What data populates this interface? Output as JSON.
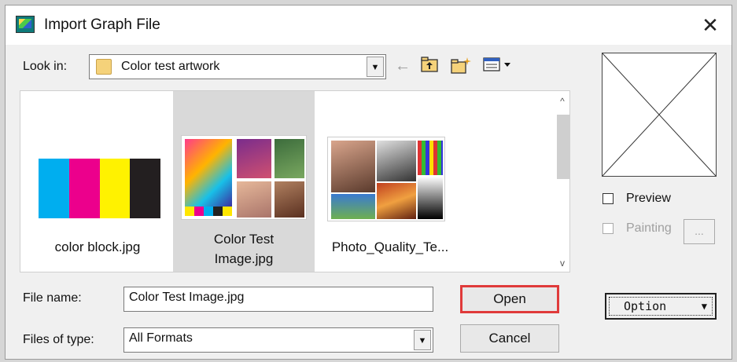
{
  "window": {
    "title": "Import Graph File",
    "close_glyph": "✕"
  },
  "lookin": {
    "label": "Look in:",
    "value": "Color test artwork",
    "icon": "folder-icon"
  },
  "toolbar": {
    "back_glyph": "←",
    "up_glyph": "⇧",
    "newfolder_glyph": "✳",
    "view_glyph": "▦▾"
  },
  "files": [
    {
      "name": "color block.jpg",
      "selected": false
    },
    {
      "name_line1": "Color Test",
      "name_line2": "Image.jpg",
      "selected": true
    },
    {
      "name": "Photo_Quality_Te...",
      "selected": false
    }
  ],
  "scroll": {
    "up_glyph": "^",
    "down_glyph": "v"
  },
  "preview": {
    "preview_label": "Preview",
    "painting_label": "Painting",
    "dots_label": "..."
  },
  "filename": {
    "label": "File name:",
    "value": "Color Test Image.jpg"
  },
  "filetype": {
    "label": "Files of type:",
    "value": "All Formats"
  },
  "buttons": {
    "open": "Open",
    "cancel": "Cancel",
    "option": "Option",
    "option_arrow": "▼"
  },
  "colors": {
    "highlight_red": "#e03a3a",
    "selection_gray": "#d9d9d9"
  }
}
